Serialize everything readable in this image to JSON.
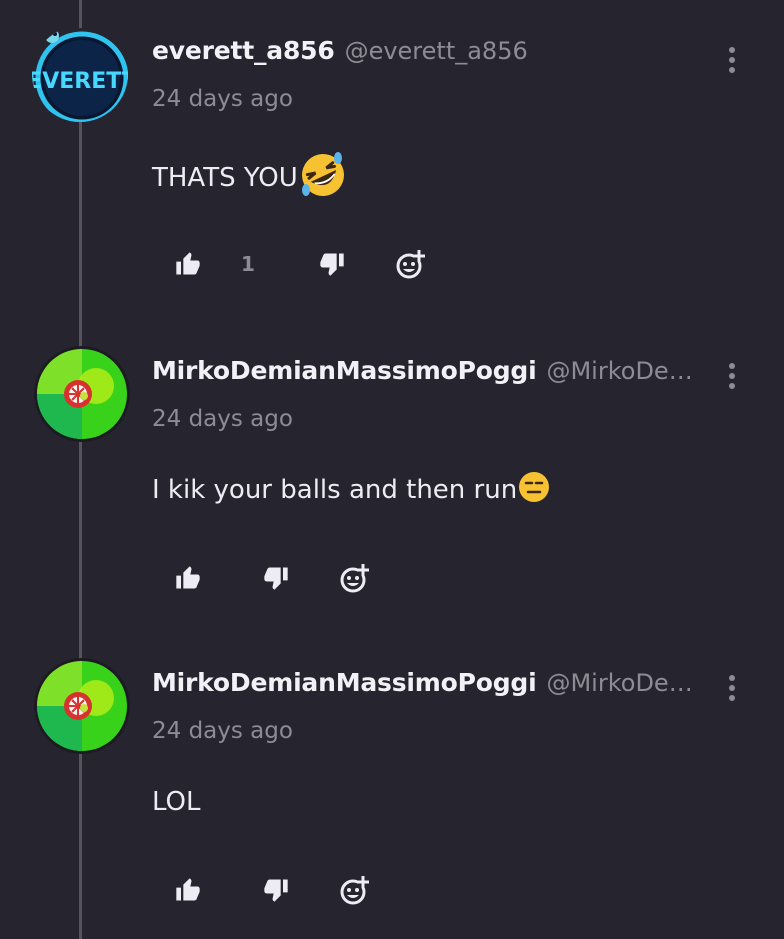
{
  "comments": [
    {
      "username": "everett_a856",
      "handle": "@everett_a856",
      "timestamp": "24 days ago",
      "text": "THATS YOU",
      "emoji": "rolling-on-floor-laughing",
      "avatar_text": "EVERETT",
      "like_count": "1",
      "avatar_colors": {
        "ring": "#2fc4f0",
        "bg": "#0a3a66",
        "text": "#48d7ff"
      }
    },
    {
      "username": "MirkoDemianMassimoPoggi",
      "handle": "@MirkoDemianMassimoPoggi",
      "timestamp": "24 days ago",
      "text": "I kik your balls and then run",
      "emoji": "expressionless-face",
      "like_count": "",
      "avatar_colors": {
        "outer": "#38d21a",
        "inner": "#9be20d",
        "accent": "#d8322e"
      }
    },
    {
      "username": "MirkoDemianMassimoPoggi",
      "handle": "@MirkoDemianMassimoPoggi",
      "timestamp": "24 days ago",
      "text": "LOL",
      "emoji": "",
      "like_count": "",
      "avatar_colors": {
        "outer": "#38d21a",
        "inner": "#9be20d",
        "accent": "#d8322e"
      }
    }
  ],
  "colors": {
    "background": "#26252f",
    "thread_line": "#55545c",
    "text_primary": "#ececf2",
    "text_secondary": "#8d8c95"
  },
  "icons": {
    "like": "thumbs-up-icon",
    "dislike": "thumbs-down-icon",
    "react": "add-reaction-icon",
    "more": "more-vertical-icon"
  }
}
